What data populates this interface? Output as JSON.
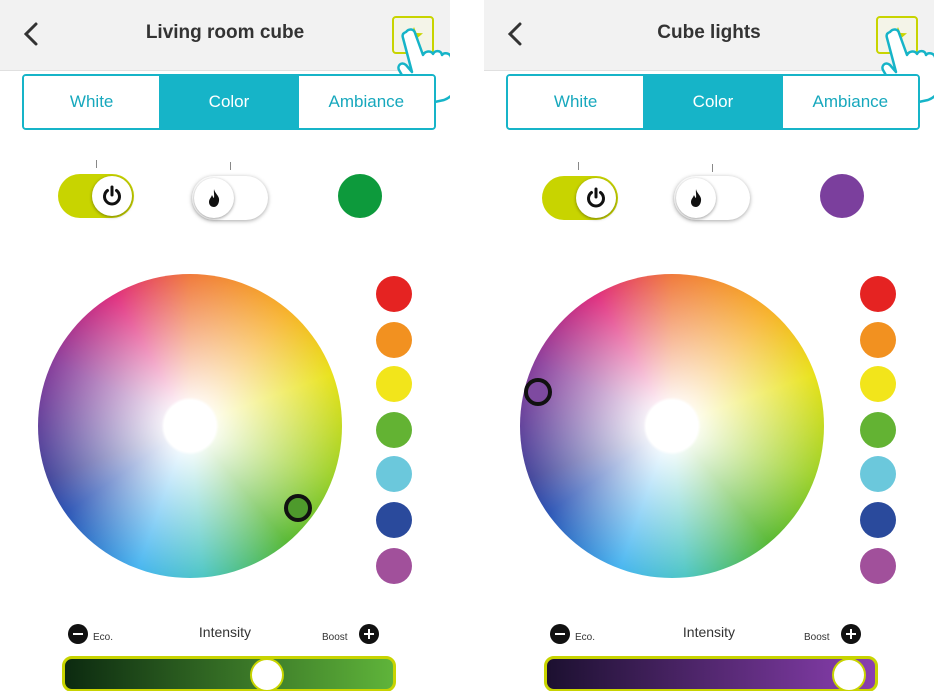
{
  "colors": {
    "accent": "#16b4c8",
    "toggle_on": "#c8d400",
    "swatch_red": "#e52322",
    "swatch_orange": "#f29120",
    "swatch_yellow": "#f2e51b",
    "swatch_green": "#63b333",
    "swatch_light_blue": "#6bc8dc",
    "swatch_dark_blue": "#2a4a9c",
    "swatch_purple": "#a1509b"
  },
  "panels": [
    {
      "title": "Living room cube",
      "tabs": [
        {
          "label": "White",
          "active": false
        },
        {
          "label": "Color",
          "active": true
        },
        {
          "label": "Ambiance",
          "active": false
        }
      ],
      "power_toggle": {
        "state": "on",
        "icon": "power-icon"
      },
      "flame_toggle": {
        "state": "off",
        "icon": "flame-icon"
      },
      "current_color": "#0d9a3c",
      "selector_color": "#4e9a2c",
      "intensity": {
        "label": "Intensity",
        "min_label": "Eco.",
        "max_label": "Boost",
        "value": 0.63,
        "track_from": "#0c2a10",
        "track_to": "#5fb43a"
      }
    },
    {
      "title": "Cube lights",
      "tabs": [
        {
          "label": "White",
          "active": false
        },
        {
          "label": "Color",
          "active": true
        },
        {
          "label": "Ambiance",
          "active": false
        }
      ],
      "power_toggle": {
        "state": "on",
        "icon": "power-icon"
      },
      "flame_toggle": {
        "state": "off",
        "icon": "flame-icon"
      },
      "current_color": "#7b3f9d",
      "selector_color": "#7e4aa0",
      "intensity": {
        "label": "Intensity",
        "min_label": "Eco.",
        "max_label": "Boost",
        "value": 0.97,
        "track_from": "#1c1030",
        "track_to": "#8a3fb0"
      }
    }
  ]
}
